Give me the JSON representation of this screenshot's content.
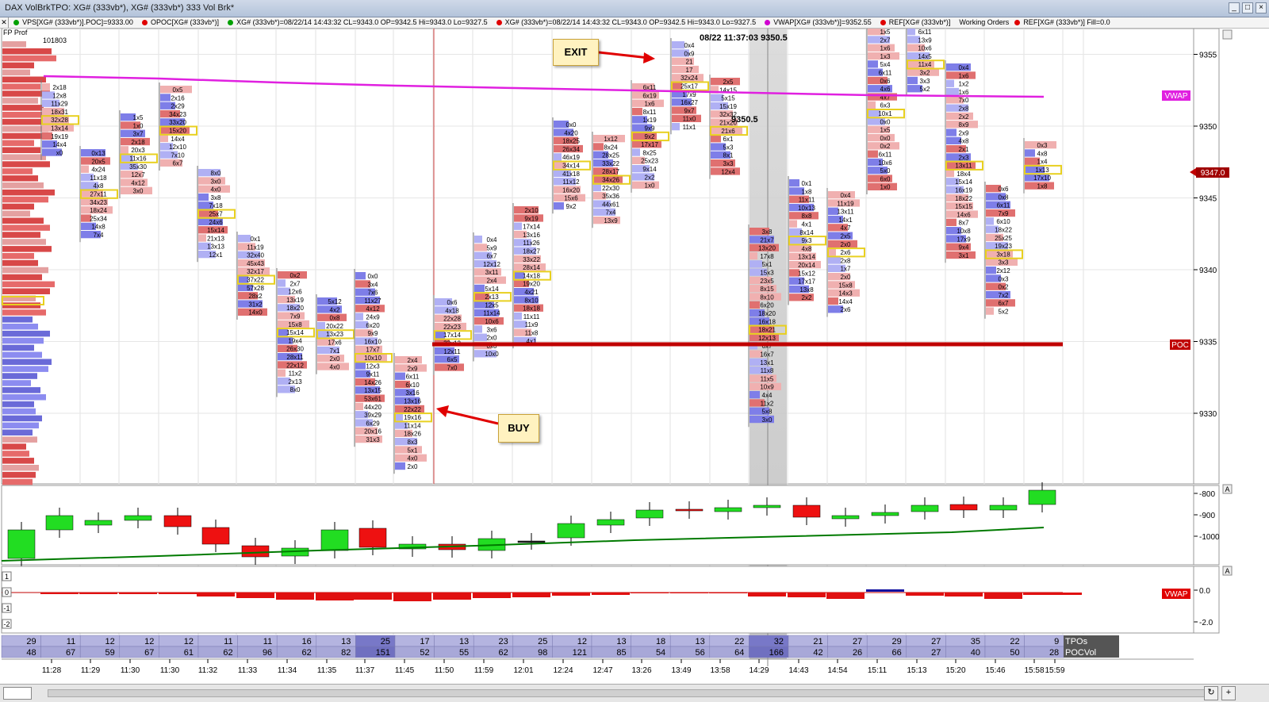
{
  "window": {
    "title": "DAX VolBrkTPO: XG# (333vb*), XG# (333vb*) 333 Vol Brk*"
  },
  "infobar": {
    "items": [
      "VPS[XG# (333vb*)].POC]=9333.00",
      "OPOC[XG# (333vb*)]",
      "XG# (333vb*)=08/22/14 14:43:32 CL=9343.0 OP=9342.5 Hi=9343.0 Lo=9327.5",
      "XG# (333vb*)=08/22/14 14:43:32 CL=9343.0 OP=9342.5 Hi=9343.0 Lo=9327.5",
      "VWAP[XG# (333vb*)]=9352.55",
      "REF[XG# (333vb*)]",
      "Working Orders",
      "REF[XG# (333vb*)] Fill=0.0"
    ],
    "colors": [
      "#00a000",
      "#e00000",
      "#00a000",
      "#d000d0",
      "#e00000",
      "#e00000"
    ]
  },
  "profile": {
    "label": "FP Prof",
    "total": "101803"
  },
  "price_axis": {
    "ticks": [
      "9355",
      "9350",
      "9345",
      "9340",
      "9335",
      "9330"
    ],
    "last_price": "9347.0",
    "vwap_label": "VWAP",
    "poc_label": "POC"
  },
  "annotations": {
    "exit": "EXIT",
    "buy": "BUY",
    "exit_stamp": "08/22 11:37:03  9350.5",
    "price_mark": "9350.5"
  },
  "osc_axis": {
    "ticks": [
      "-800",
      "-900",
      "-1000"
    ],
    "corner": "A"
  },
  "bottom_axis": {
    "ticks": [
      "0.0",
      "-2.0"
    ],
    "left_ticks": [
      "1",
      "0",
      "-1",
      "-2"
    ],
    "vwap_label": "VWAP",
    "corner": "A"
  },
  "table": {
    "tpos_label": "TPOs",
    "pocvol_label": "POCVol",
    "tpos": [
      "29",
      "11",
      "12",
      "12",
      "12",
      "11",
      "11",
      "16",
      "13",
      "25",
      "17",
      "13",
      "23",
      "25",
      "12",
      "13",
      "18",
      "13",
      "22",
      "32",
      "21",
      "27",
      "29",
      "27",
      "35",
      "22",
      "9"
    ],
    "pocvol": [
      "48",
      "67",
      "59",
      "67",
      "61",
      "62",
      "96",
      "62",
      "82",
      "151",
      "52",
      "55",
      "62",
      "98",
      "121",
      "85",
      "54",
      "56",
      "64",
      "166",
      "42",
      "26",
      "66",
      "27",
      "40",
      "50",
      "28"
    ]
  },
  "time_axis": {
    "labels": [
      "11:28",
      "11:29",
      "11:30",
      "11:30",
      "11:32",
      "11:33",
      "11:34",
      "11:35",
      "11:37",
      "11:45",
      "11:50",
      "11:59",
      "12:01",
      "12:24",
      "12:47",
      "13:26",
      "13:49",
      "13:58",
      "14:29",
      "14:43",
      "14:54",
      "15:11",
      "15:13",
      "15:20",
      "15:46",
      "15:58",
      "15:59"
    ]
  },
  "footprint_texts": [
    [
      "2x18",
      "12x8",
      "11x29",
      "18x31",
      "32x28",
      "13x14",
      "19x19",
      "14x4",
      "x0"
    ],
    [
      "0x13",
      "20x5",
      "4x24",
      "11x18",
      "4x8",
      "27x11",
      "34x23",
      "18x24",
      "25x34",
      "14x8",
      "7x4"
    ],
    [
      "1x5",
      "1x0",
      "3x7",
      "2x18",
      "20x3",
      "11x16",
      "35x30",
      "12x7",
      "4x12",
      "3x0"
    ],
    [
      "0x5",
      "2x16",
      "2x29",
      "34x23",
      "33x20",
      "15x20",
      "14x4",
      "12x10",
      "7x10",
      "6x7"
    ],
    [
      "8x0",
      "3x0",
      "4x0",
      "3x8",
      "7x18",
      "25x7",
      "24x6",
      "15x14",
      "21x13",
      "13x13",
      "12x1"
    ],
    [
      "0x1",
      "11x19",
      "32x40",
      "45x43",
      "32x17",
      "37x22",
      "57x28",
      "28x2",
      "31x2",
      "14x0"
    ],
    [
      "0x2",
      "2x7",
      "12x6",
      "13x19",
      "18x20",
      "7x9",
      "15x8",
      "15x14",
      "19x4",
      "26x30",
      "28x11",
      "22x12",
      "11x2",
      "2x13",
      "8x0"
    ],
    [
      "5x12",
      "4x2",
      "0x8",
      "20x22",
      "13x23",
      "17x6",
      "7x1",
      "2x0",
      "4x0"
    ],
    [
      "0x0",
      "3x4",
      "7x6",
      "11x27",
      "4x12",
      "24x9",
      "6x20",
      "9x9",
      "16x10",
      "17x7",
      "10x10",
      "12x3",
      "9x11",
      "14x26",
      "13x15",
      "53x61",
      "44x20",
      "39x29",
      "6x29",
      "20x16",
      "31x3"
    ],
    [
      "2x4",
      "2x9",
      "6x11",
      "6x10",
      "3x16",
      "13x16",
      "22x22",
      "19x16",
      "11x14",
      "18x26",
      "8x3",
      "5x1",
      "4x0",
      "2x0"
    ],
    [
      "0x6",
      "4x18",
      "22x28",
      "22x23",
      "17x14",
      "33x13",
      "12x11",
      "6x5",
      "7x0"
    ],
    [
      "0x4",
      "5x9",
      "6x7",
      "12x12",
      "3x11",
      "2x4",
      "5x14",
      "2x13",
      "12x5",
      "11x14",
      "10x6",
      "3x6",
      "2x0",
      "0x0",
      "10x0"
    ],
    [
      "2x10",
      "9x19",
      "17x14",
      "13x16",
      "11x26",
      "18x27",
      "33x22",
      "28x14",
      "14x18",
      "19x20",
      "4x21",
      "8x10",
      "18x18",
      "11x11",
      "11x9",
      "11x8",
      "4x1"
    ],
    [
      "0x0",
      "4x20",
      "18x25",
      "26x34",
      "46x19",
      "34x14",
      "41x18",
      "11x12",
      "16x20",
      "15x6",
      "9x2"
    ],
    [
      "1x12",
      "8x24",
      "28x25",
      "33x22",
      "28x17",
      "34x26",
      "22x30",
      "35x36",
      "44x61",
      "7x4",
      "13x9"
    ],
    [
      "6x11",
      "6x19",
      "1x6",
      "8x11",
      "1x19",
      "9x9",
      "9x2",
      "17x17",
      "8x25",
      "25x23",
      "9x14",
      "2x2",
      "1x0"
    ],
    [
      "0x4",
      "0x9",
      "21",
      "17",
      "32x24",
      "25x17",
      "17x9",
      "16x27",
      "9x7",
      "11x0",
      "11x1"
    ],
    [
      "2x5",
      "14x15",
      "5x15",
      "15x19",
      "32x32",
      "21x20",
      "21x6",
      "6x1",
      "5x3",
      "8x1",
      "3x3",
      "12x4"
    ],
    [
      "3x8",
      "21x7",
      "13x20",
      "17x8",
      "5x1",
      "15x3",
      "23x5",
      "8x15",
      "8x10",
      "6x20",
      "18x20",
      "16x18",
      "18x21",
      "12x13",
      "6x7",
      "16x7",
      "13x1",
      "11x8",
      "11x5",
      "10x9",
      "4x4",
      "11x2",
      "5x8",
      "3x0"
    ],
    [
      "0x1",
      "1x8",
      "11x11",
      "10x13",
      "8x8",
      "4x1",
      "8x14",
      "9x3",
      "4x8",
      "13x14",
      "20x14",
      "15x12",
      "17x17",
      "13x8",
      "2x2"
    ],
    [
      "0x4",
      "11x19",
      "13x11",
      "14x1",
      "4x7",
      "2x5",
      "2x0",
      "2x6",
      "2x8",
      "1x7",
      "2x0",
      "15x8",
      "14x3",
      "14x4",
      "2x6"
    ],
    [
      "1x5",
      "2x7",
      "1x6",
      "1x3",
      "5x4",
      "6x11",
      "0x6",
      "4x6",
      "4x7",
      "6x3",
      "10x1",
      "0x0",
      "1x5",
      "0x0",
      "0x2",
      "6x11",
      "10x6",
      "5x0",
      "6x0",
      "1x0"
    ],
    [
      "6x11",
      "13x9",
      "10x6",
      "14x5",
      "11x4",
      "3x2",
      "3x3",
      "5x2"
    ],
    [
      "0x4",
      "1x6",
      "1x2",
      "1x6",
      "7x0",
      "2x8",
      "2x2",
      "8x9",
      "2x9",
      "4x8",
      "2x1",
      "2x3",
      "13x11",
      "18x4",
      "15x14",
      "16x19",
      "18x22",
      "15x15",
      "14x6",
      "8x7",
      "10x8",
      "17x9",
      "9x4",
      "3x1"
    ],
    [
      "0x6",
      "0x8",
      "6x11",
      "7x9",
      "6x10",
      "18x22",
      "25x25",
      "19x23",
      "3x18",
      "3x3",
      "2x12",
      "0x3",
      "0x2",
      "7x2",
      "6x7",
      "5x2"
    ],
    [
      "0x3",
      "4x8",
      "1x4",
      "1x13",
      "17x10",
      "1x8"
    ]
  ]
}
